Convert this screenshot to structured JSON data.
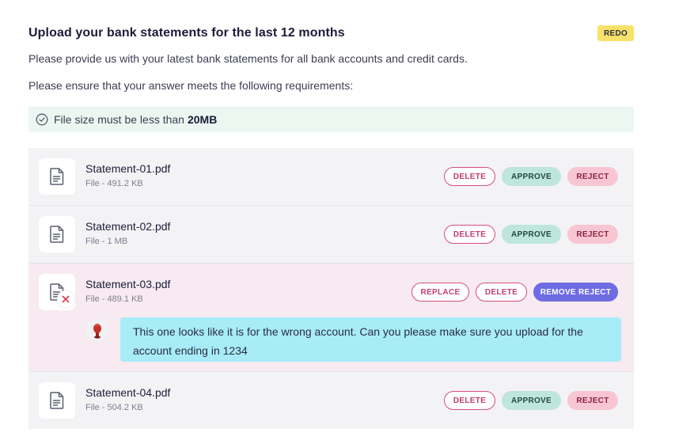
{
  "header": {
    "title": "Upload your bank statements for the last 12 months",
    "badge": "REDO",
    "description": "Please provide us with your latest bank statements for all bank accounts and credit cards.",
    "requirements_intro": "Please ensure that your answer meets the following requirements:"
  },
  "requirement": {
    "text": "File size must be less than",
    "value": "20MB"
  },
  "files": [
    {
      "name": "Statement-01.pdf",
      "meta": "File - 491.2 KB",
      "status": "pending",
      "actions": {
        "delete": "DELETE",
        "approve": "APPROVE",
        "reject": "REJECT"
      }
    },
    {
      "name": "Statement-02.pdf",
      "meta": "File - 1 MB",
      "status": "pending",
      "actions": {
        "delete": "DELETE",
        "approve": "APPROVE",
        "reject": "REJECT"
      }
    },
    {
      "name": "Statement-03.pdf",
      "meta": "File - 489.1 KB",
      "status": "rejected",
      "actions": {
        "replace": "REPLACE",
        "delete": "DELETE",
        "remove_reject": "REMOVE REJECT"
      },
      "comment": "This one looks like it is for the wrong account. Can you please make sure you upload for the account ending in 1234"
    },
    {
      "name": "Statement-04.pdf",
      "meta": "File - 504.2 KB",
      "status": "pending",
      "actions": {
        "delete": "DELETE",
        "approve": "APPROVE",
        "reject": "REJECT"
      }
    }
  ],
  "icons": {
    "requirement": "check-circle-icon",
    "file": "document-icon",
    "rejected": "close-icon",
    "avatar": "user-avatar"
  },
  "colors": {
    "badge": "#f9e26b",
    "requirement_bg": "#ecf7f1",
    "row_bg": "#f3f3f5",
    "rejected_row_bg": "#f7eaf0",
    "outline_button": "#d64b83",
    "approve": "#bfe6db",
    "reject": "#f8c6d2",
    "remove_reject": "#6d6ce3",
    "comment_bubble": "#a7ecf7"
  }
}
